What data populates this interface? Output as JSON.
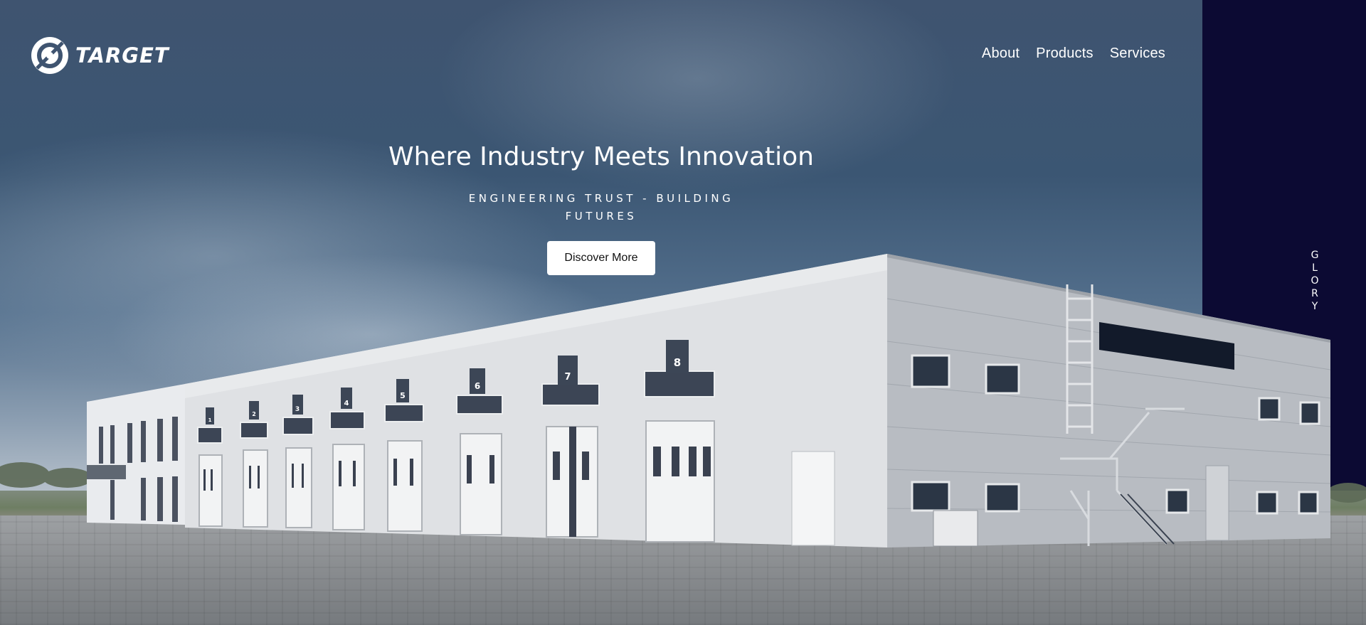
{
  "brand": {
    "name": "TARGET"
  },
  "nav": {
    "items": [
      {
        "label": "About"
      },
      {
        "label": "Products"
      },
      {
        "label": "Services"
      }
    ]
  },
  "hero": {
    "title": "Where Industry Meets Innovation",
    "subtitle": "ENGINEERING TRUST - BUILDING FUTURES",
    "cta_label": "Discover More"
  },
  "side": {
    "vertical_text": "GLORY",
    "panel_color": "#0c0a33"
  },
  "building": {
    "bay_numbers": [
      "1",
      "2",
      "3",
      "4",
      "5",
      "6",
      "7",
      "8"
    ]
  },
  "colors": {
    "text": "#ffffff",
    "button_bg": "#ffffff",
    "button_text": "#111111"
  },
  "icons": {
    "logo": "target-logo-icon"
  }
}
